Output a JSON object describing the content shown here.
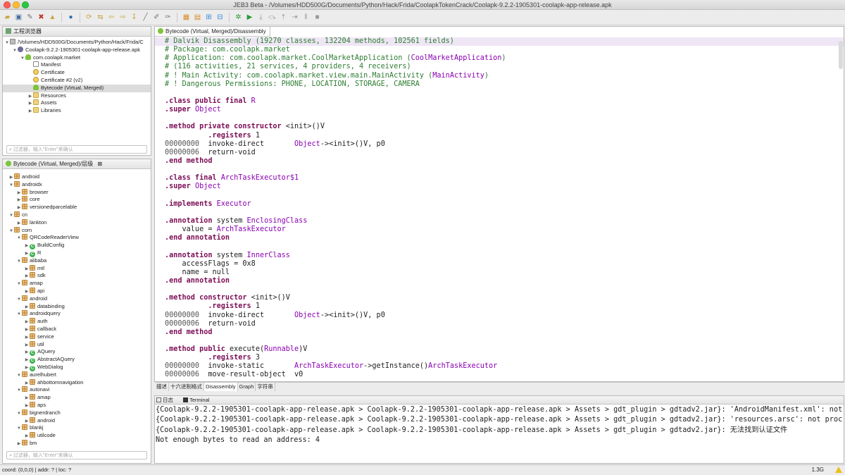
{
  "window": {
    "title": "JEB3 Beta - /Volumes/HDD500G/Documents/Python/Hack/Frida/CoolapkTokenCrack/Coolapk-9.2.2-1905301-coolapk-app-release.apk"
  },
  "explorer": {
    "tab_label": "工程浏览器",
    "tree": [
      {
        "indent": 0,
        "arrow": "▼",
        "icon": "folderapk",
        "label": "/Volumes/HDD500G/Documents/Python/Hack/Frida/C"
      },
      {
        "indent": 1,
        "arrow": "▼",
        "icon": "apk",
        "label": "Coolapk-9.2.2-1905301-coolapk-app-release.apk"
      },
      {
        "indent": 2,
        "arrow": "▼",
        "icon": "droid",
        "label": "com.coolapk.market"
      },
      {
        "indent": 3,
        "arrow": "",
        "icon": "file",
        "label": "Manifest"
      },
      {
        "indent": 3,
        "arrow": "",
        "icon": "cert",
        "label": "Certificate"
      },
      {
        "indent": 3,
        "arrow": "",
        "icon": "cert",
        "label": "Certificate #2 (v2)"
      },
      {
        "indent": 3,
        "arrow": "",
        "icon": "droid",
        "label": "Bytecode (Virtual, Merged)",
        "selected": true
      },
      {
        "indent": 3,
        "arrow": "▶",
        "icon": "folder",
        "label": "Resources"
      },
      {
        "indent": 3,
        "arrow": "▶",
        "icon": "folder",
        "label": "Assets"
      },
      {
        "indent": 3,
        "arrow": "▶",
        "icon": "folder",
        "label": "Libraries"
      }
    ],
    "filter_placeholder": "过滤器，输入\"Enter\"来确认"
  },
  "hierarchy": {
    "tab_label": "Bytecode (Virtual, Merged)/层级",
    "filter_placeholder": "过滤器，输入\"Enter\"来确认",
    "tree": [
      {
        "indent": 0,
        "arrow": "▶",
        "icon": "pkg",
        "label": "android"
      },
      {
        "indent": 0,
        "arrow": "▼",
        "icon": "pkg",
        "label": "androidx"
      },
      {
        "indent": 1,
        "arrow": "▶",
        "icon": "pkg",
        "label": "browser"
      },
      {
        "indent": 1,
        "arrow": "▶",
        "icon": "pkg",
        "label": "core"
      },
      {
        "indent": 1,
        "arrow": "▶",
        "icon": "pkg",
        "label": "versionedparcelable"
      },
      {
        "indent": 0,
        "arrow": "▼",
        "icon": "pkg",
        "label": "cn"
      },
      {
        "indent": 1,
        "arrow": "▶",
        "icon": "pkg",
        "label": "lankton"
      },
      {
        "indent": 0,
        "arrow": "▼",
        "icon": "pkg",
        "label": "com"
      },
      {
        "indent": 1,
        "arrow": "▼",
        "icon": "pkg",
        "label": "QRCodeReaderView"
      },
      {
        "indent": 2,
        "arrow": "▶",
        "icon": "cls",
        "label": "BuildConfig"
      },
      {
        "indent": 2,
        "arrow": "▶",
        "icon": "cls",
        "label": "R"
      },
      {
        "indent": 1,
        "arrow": "▼",
        "icon": "pkg",
        "label": "alibaba"
      },
      {
        "indent": 2,
        "arrow": "▶",
        "icon": "pkg",
        "label": "mtl"
      },
      {
        "indent": 2,
        "arrow": "▶",
        "icon": "pkg",
        "label": "sdk"
      },
      {
        "indent": 1,
        "arrow": "▼",
        "icon": "pkg",
        "label": "amap"
      },
      {
        "indent": 2,
        "arrow": "▶",
        "icon": "pkg",
        "label": "api"
      },
      {
        "indent": 1,
        "arrow": "▼",
        "icon": "pkg",
        "label": "android"
      },
      {
        "indent": 2,
        "arrow": "▶",
        "icon": "pkg",
        "label": "databinding"
      },
      {
        "indent": 1,
        "arrow": "▼",
        "icon": "pkg",
        "label": "androidquery"
      },
      {
        "indent": 2,
        "arrow": "▶",
        "icon": "pkg",
        "label": "auth"
      },
      {
        "indent": 2,
        "arrow": "▶",
        "icon": "pkg",
        "label": "callback"
      },
      {
        "indent": 2,
        "arrow": "▶",
        "icon": "pkg",
        "label": "service"
      },
      {
        "indent": 2,
        "arrow": "▶",
        "icon": "pkg",
        "label": "util"
      },
      {
        "indent": 2,
        "arrow": "▶",
        "icon": "cls",
        "label": "AQuery"
      },
      {
        "indent": 2,
        "arrow": "▶",
        "icon": "cls",
        "label": "AbstractAQuery"
      },
      {
        "indent": 2,
        "arrow": "▶",
        "icon": "cls",
        "label": "WebDialog"
      },
      {
        "indent": 1,
        "arrow": "▼",
        "icon": "pkg",
        "label": "aurelhubert"
      },
      {
        "indent": 2,
        "arrow": "▶",
        "icon": "pkg",
        "label": "ahbottomnavigation"
      },
      {
        "indent": 1,
        "arrow": "▼",
        "icon": "pkg",
        "label": "autonavi"
      },
      {
        "indent": 2,
        "arrow": "▶",
        "icon": "pkg",
        "label": "amap"
      },
      {
        "indent": 2,
        "arrow": "▶",
        "icon": "pkg",
        "label": "aps"
      },
      {
        "indent": 1,
        "arrow": "▼",
        "icon": "pkg",
        "label": "bignerdranch"
      },
      {
        "indent": 2,
        "arrow": "▶",
        "icon": "pkg",
        "label": "android"
      },
      {
        "indent": 1,
        "arrow": "▼",
        "icon": "pkg",
        "label": "blankj"
      },
      {
        "indent": 2,
        "arrow": "▶",
        "icon": "pkg",
        "label": "utilcode"
      },
      {
        "indent": 1,
        "arrow": "▶",
        "icon": "pkg",
        "label": "bm"
      }
    ]
  },
  "editor": {
    "tab_label": "Bytecode (Virtual, Merged)/Disassembly",
    "lines": [
      [
        [
          "cmt",
          "# Dalvik Disassembly (19270 classes, 132204 methods, 102561 fields)"
        ]
      ],
      [
        [
          "cmt",
          "# Package: com.coolapk.market"
        ]
      ],
      [
        [
          "cmt",
          "# Application: com.coolapk.market.CoolMarketApplication ("
        ],
        [
          "ty",
          "CoolMarketApplication"
        ],
        [
          "cmt",
          ")"
        ]
      ],
      [
        [
          "cmt",
          "# (116 activities, 21 services, 4 providers, 4 receivers)"
        ]
      ],
      [
        [
          "cmt",
          "# ! Main Activity: com.coolapk.market.view.main.MainActivity ("
        ],
        [
          "ty",
          "MainActivity"
        ],
        [
          "cmt",
          ")"
        ]
      ],
      [
        [
          "cmt",
          "# ! Dangerous Permissions: PHONE, LOCATION, STORAGE, CAMERA"
        ]
      ],
      [],
      [
        [
          "kw",
          ".class public final "
        ],
        [
          "ty",
          "R"
        ]
      ],
      [
        [
          "kw",
          ".super "
        ],
        [
          "ty",
          "Object"
        ]
      ],
      [],
      [
        [
          "kw",
          ".method private constructor "
        ],
        [
          "",
          "<init>()V"
        ]
      ],
      [
        [
          "",
          "          "
        ],
        [
          "kw",
          ".registers "
        ],
        [
          "",
          "1"
        ]
      ],
      [
        [
          "ad",
          "00000000"
        ],
        [
          "",
          "  invoke-direct       "
        ],
        [
          "ty",
          "Object"
        ],
        [
          "",
          "-><init>()V, p0"
        ]
      ],
      [
        [
          "ad",
          "00000006"
        ],
        [
          "",
          "  return-void"
        ]
      ],
      [
        [
          "kw",
          ".end method"
        ]
      ],
      [],
      [
        [
          "kw",
          ".class final "
        ],
        [
          "ty",
          "ArchTaskExecutor$1"
        ]
      ],
      [
        [
          "kw",
          ".super "
        ],
        [
          "ty",
          "Object"
        ]
      ],
      [],
      [
        [
          "kw",
          ".implements "
        ],
        [
          "ty",
          "Executor"
        ]
      ],
      [],
      [
        [
          "kw",
          ".annotation "
        ],
        [
          "",
          "system "
        ],
        [
          "ty",
          "EnclosingClass"
        ]
      ],
      [
        [
          "",
          "    value = "
        ],
        [
          "ty",
          "ArchTaskExecutor"
        ]
      ],
      [
        [
          "kw",
          ".end annotation"
        ]
      ],
      [],
      [
        [
          "kw",
          ".annotation "
        ],
        [
          "",
          "system "
        ],
        [
          "ty",
          "InnerClass"
        ]
      ],
      [
        [
          "",
          "    accessFlags = 0x8"
        ]
      ],
      [
        [
          "",
          "    name = null"
        ]
      ],
      [
        [
          "kw",
          ".end annotation"
        ]
      ],
      [],
      [
        [
          "kw",
          ".method constructor "
        ],
        [
          "",
          "<init>()V"
        ]
      ],
      [
        [
          "",
          "          "
        ],
        [
          "kw",
          ".registers "
        ],
        [
          "",
          "1"
        ]
      ],
      [
        [
          "ad",
          "00000000"
        ],
        [
          "",
          "  invoke-direct       "
        ],
        [
          "ty",
          "Object"
        ],
        [
          "",
          "-><init>()V, p0"
        ]
      ],
      [
        [
          "ad",
          "00000006"
        ],
        [
          "",
          "  return-void"
        ]
      ],
      [
        [
          "kw",
          ".end method"
        ]
      ],
      [],
      [
        [
          "kw",
          ".method public "
        ],
        [
          "",
          "execute("
        ],
        [
          "ty",
          "Runnable"
        ],
        [
          "",
          ")V"
        ]
      ],
      [
        [
          "",
          "          "
        ],
        [
          "kw",
          ".registers "
        ],
        [
          "",
          "3"
        ]
      ],
      [
        [
          "ad",
          "00000000"
        ],
        [
          "",
          "  invoke-static       "
        ],
        [
          "ty",
          "ArchTaskExecutor"
        ],
        [
          "",
          "->getInstance()"
        ],
        [
          "ty",
          "ArchTaskExecutor"
        ]
      ],
      [
        [
          "ad",
          "00000006"
        ],
        [
          "",
          "  move-result-object  v0"
        ]
      ]
    ]
  },
  "subtabs": [
    "描述",
    "十六进制格式",
    "Disassembly",
    "Graph",
    "字符串"
  ],
  "subtabs_active": 2,
  "console": {
    "tabs": [
      "日志",
      "Terminal"
    ],
    "lines": [
      "{Coolapk-9.2.2-1905301-coolapk-app-release.apk > Coolapk-9.2.2-1905301-coolapk-app-release.apk > Assets > gdt_plugin > gdtadv2.jar}: 'AndroidManifest.xml': not",
      "{Coolapk-9.2.2-1905301-coolapk-app-release.apk > Coolapk-9.2.2-1905301-coolapk-app-release.apk > Assets > gdt_plugin > gdtadv2.jar}: 'resources.arsc': not proc",
      "{Coolapk-9.2.2-1905301-coolapk-app-release.apk > Coolapk-9.2.2-1905301-coolapk-app-release.apk > Assets > gdt_plugin > gdtadv2.jar}: 无法找到认证文件",
      "Not enough bytes to read an address: 4"
    ]
  },
  "statusbar": {
    "text": "coord: (0,0,0) | addr: ? | loc: ?",
    "memory": "1.3G"
  },
  "colors": {
    "comment": "#2e7d32",
    "keyword": "#7b0d55",
    "type": "#8b00b3",
    "highlight": "#efe6f5"
  }
}
